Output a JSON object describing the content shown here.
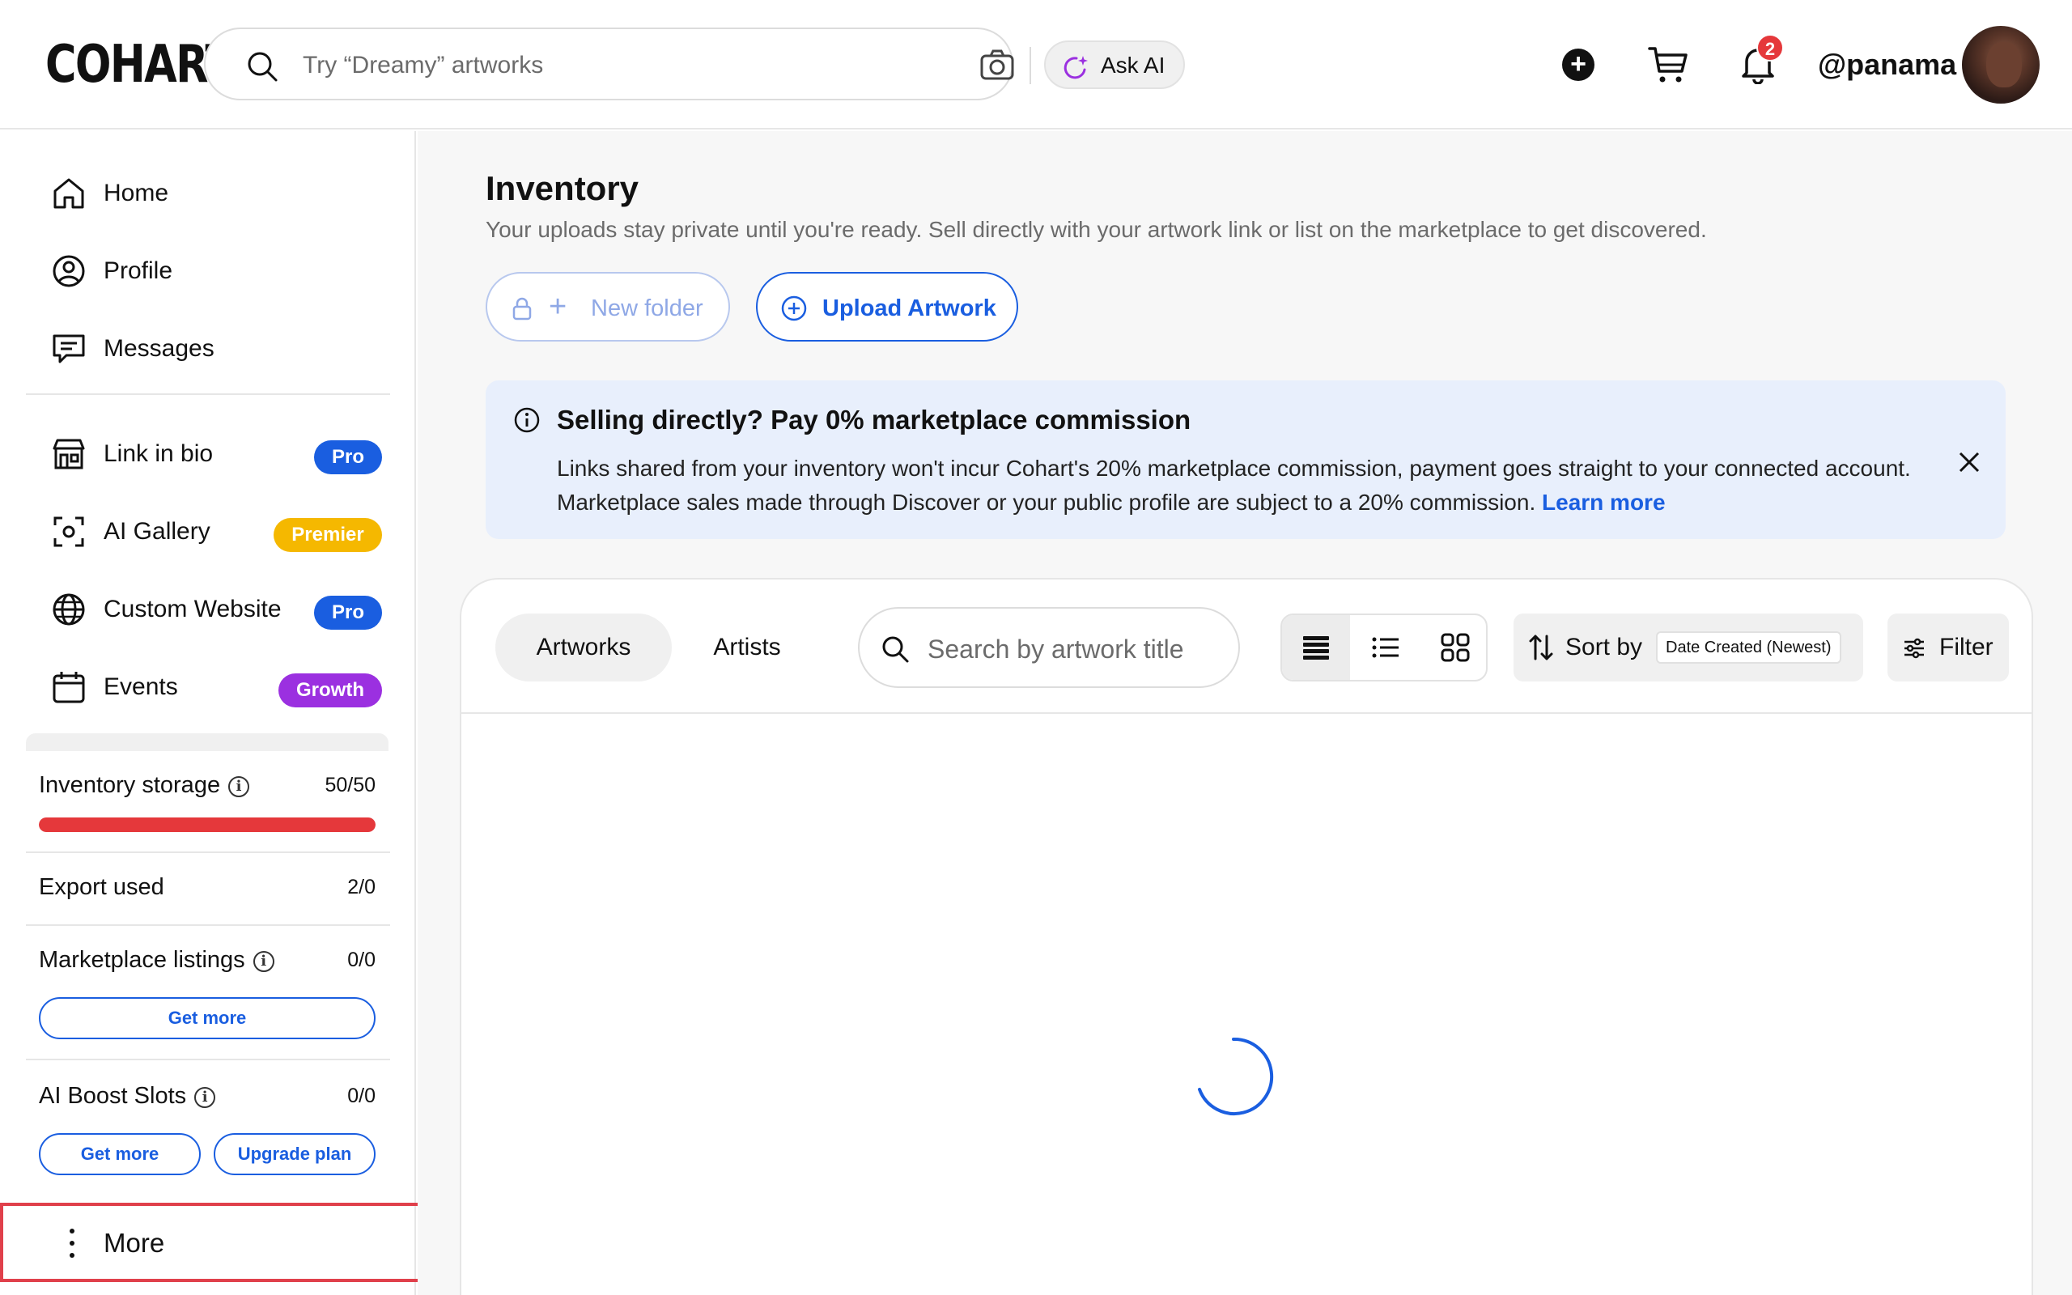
{
  "header": {
    "logo": "COHART",
    "search_placeholder": "Try “Dreamy” artworks",
    "ask_ai_label": "Ask AI",
    "notification_count": "2",
    "username": "@panama"
  },
  "sidebar": {
    "nav": [
      {
        "label": "Home",
        "icon": "home-icon"
      },
      {
        "label": "Profile",
        "icon": "user-icon"
      },
      {
        "label": "Messages",
        "icon": "message-icon"
      }
    ],
    "features": [
      {
        "label": "Link in bio",
        "badge": "Pro",
        "icon": "store-icon"
      },
      {
        "label": "AI Gallery",
        "badge": "Premier",
        "icon": "scan-icon"
      },
      {
        "label": "Custom Website",
        "badge": "Pro",
        "icon": "globe-icon"
      },
      {
        "label": "Events",
        "badge": "Growth",
        "icon": "calendar-icon"
      }
    ],
    "usage": {
      "inventory_storage": {
        "label": "Inventory storage",
        "value": "50/50",
        "fraction": 1.0
      },
      "export_used": {
        "label": "Export used",
        "value": "2/0"
      },
      "marketplace_listings": {
        "label": "Marketplace listings",
        "value": "0/0",
        "button": "Get more"
      },
      "ai_boost_slots": {
        "label": "AI Boost Slots",
        "value": "0/0",
        "get_more": "Get more",
        "upgrade": "Upgrade plan"
      }
    },
    "more_label": "More"
  },
  "main": {
    "title": "Inventory",
    "subtitle": "Your uploads stay private until you're ready. Sell directly with your artwork link or list on the marketplace to get discovered.",
    "new_folder_label": "New folder",
    "upload_label": "Upload Artwork",
    "banner": {
      "title": "Selling directly? Pay 0% marketplace commission",
      "text": "Links shared from your inventory won't incur Cohart's 20% marketplace commission, payment goes straight to your connected account. Marketplace sales made through Discover or your public profile are subject to a 20% commission.",
      "link": "Learn more"
    },
    "tabs": [
      "Artworks",
      "Artists"
    ],
    "search_placeholder": "Search by artwork title",
    "sort_label": "Sort by",
    "sort_value": "Date Created (Newest)",
    "filter_label": "Filter"
  },
  "colors": {
    "accent": "#1a5ee0",
    "danger": "#e5383b",
    "premier": "#f5b800",
    "growth": "#9b30e0",
    "banner_bg": "#e8effc"
  }
}
